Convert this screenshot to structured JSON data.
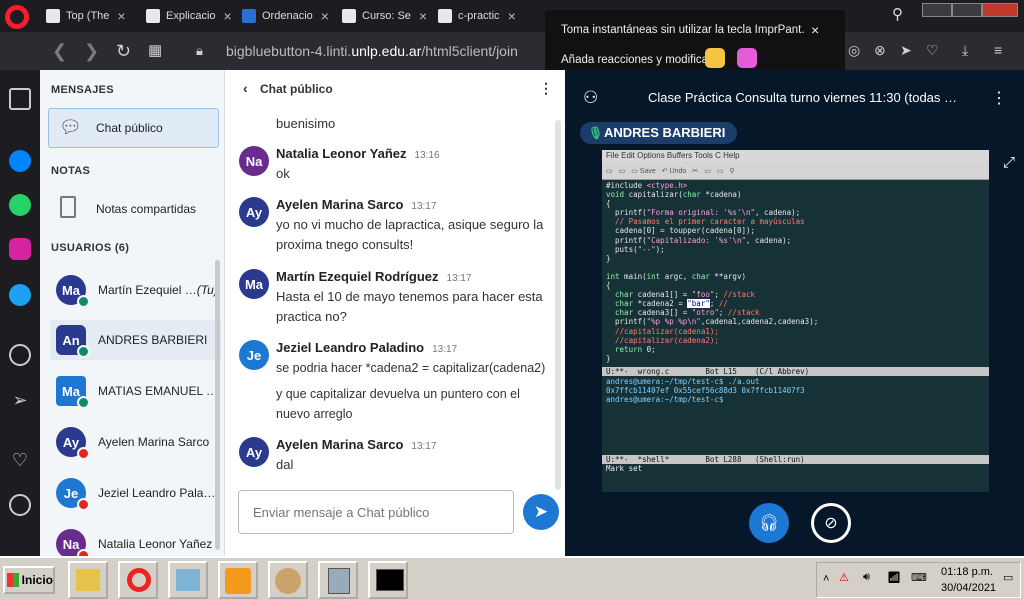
{
  "browser": {
    "tabs": [
      "Top (The",
      "Explicacio",
      "Ordenacio",
      "Curso: Se",
      "c-practic"
    ],
    "url_prefix": "bigbluebutton-4.linti.",
    "url_domain": "unlp.edu.ar",
    "url_suffix": "/html5client/join"
  },
  "toast": {
    "line1": "Toma instantáneas sin utilizar la tecla ImprPant.",
    "line2": "Añada reacciones y modifica",
    "close": "×"
  },
  "sidebar": {
    "messages_title": "MENSAJES",
    "public_chat": "Chat público",
    "notes_title": "NOTAS",
    "shared_notes": "Notas compartidas",
    "users_title": "USUARIOS (6)",
    "users": [
      {
        "initials": "Ma",
        "name": "Martín Ezequiel …",
        "suffix": "(Tu)",
        "color": "#2b3a8f",
        "status": "listen"
      },
      {
        "initials": "An",
        "name": "ANDRES BARBIERI",
        "color": "#2b3a8f",
        "status": "listen"
      },
      {
        "initials": "Ma",
        "name": "MATIAS EMANUEL F…",
        "color": "#1c78d2",
        "status": "listen"
      },
      {
        "initials": "Ay",
        "name": "Ayelen Marina Sarco",
        "color": "#2b3a8f",
        "status": "muted"
      },
      {
        "initials": "Je",
        "name": "Jeziel Leandro Pala…",
        "color": "#1c78d2",
        "status": "muted"
      },
      {
        "initials": "Na",
        "name": "Natalia Leonor Yañez",
        "color": "#6a2b8f",
        "status": "muted"
      }
    ]
  },
  "chat": {
    "title": "Chat público",
    "top_fragment": "buenisimo",
    "messages": [
      {
        "initials": "Na",
        "name": "Natalia Leonor Yañez",
        "time": "13:16",
        "lines": [
          "ok"
        ],
        "color": "#6a2b8f"
      },
      {
        "initials": "Ay",
        "name": "Ayelen Marina Sarco",
        "time": "13:17",
        "lines": [
          "yo no vi mucho de lapractica, asique seguro la",
          "proxima tnego consults!"
        ],
        "color": "#2b3a8f"
      },
      {
        "initials": "Ma",
        "name": "Martín Ezequiel Rodríguez",
        "time": "13:17",
        "lines": [
          "Hasta el 10 de mayo tenemos para hacer esta",
          "practica no?"
        ],
        "color": "#2b3a8f"
      },
      {
        "initials": "Je",
        "name": "Jeziel Leandro Paladino",
        "time": "13:17",
        "lines": [
          "se podria hacer *cadena2 = capitalizar(cadena2)",
          "y que capitalizar devuelva un puntero con el",
          "nuevo arreglo"
        ],
        "color": "#1c78d2"
      },
      {
        "initials": "Ay",
        "name": "Ayelen Marina Sarco",
        "time": "13:17",
        "lines": [
          "dal"
        ],
        "color": "#2b3a8f"
      }
    ],
    "input_placeholder": "Enviar mensaje a Chat público"
  },
  "stage": {
    "title": "Clase Práctica Consulta turno viernes 11:30 (todas …",
    "presenter": "ANDRES BARBIERI"
  },
  "emacs": {
    "menu": "File  Edit  Options  Buffers  Tools  C  Help",
    "modeline1": "U:**-  wrong.c        Bot L15    (C/l Abbrev)",
    "modeline2": "U:**-  *shell*        Bot L288   (Shell:run)",
    "minibuffer": "Mark set",
    "shell": [
      "andres@umera:~/tmp/test-c$ ./a.out",
      "0x7ffcb11407ef 0x55cef56c88d3 0x7ffcb11407f3",
      "andres@umera:~/tmp/test-c$"
    ]
  },
  "taskbar": {
    "start": "Inicio",
    "time": "01:18 p.m.",
    "date": "30/04/2021"
  }
}
